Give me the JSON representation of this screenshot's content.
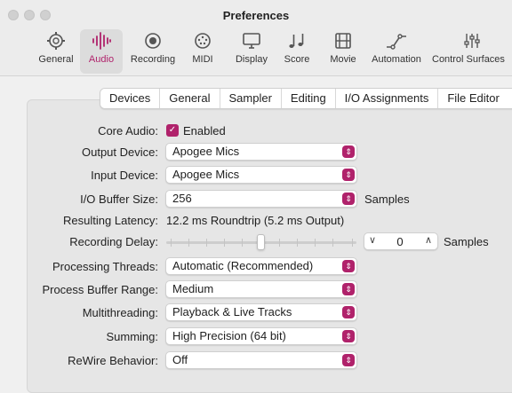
{
  "window": {
    "title": "Preferences"
  },
  "toolbar": [
    {
      "label": "General",
      "icon": "gear-icon"
    },
    {
      "label": "Audio",
      "icon": "waveform-icon"
    },
    {
      "label": "Recording",
      "icon": "record-icon"
    },
    {
      "label": "MIDI",
      "icon": "midi-icon"
    },
    {
      "label": "Display",
      "icon": "display-icon"
    },
    {
      "label": "Score",
      "icon": "notes-icon"
    },
    {
      "label": "Movie",
      "icon": "film-icon"
    },
    {
      "label": "Automation",
      "icon": "automation-icon"
    },
    {
      "label": "Control Surfaces",
      "icon": "sliders-icon"
    }
  ],
  "selected_tab": "Audio",
  "subtabs": [
    "Devices",
    "General",
    "Sampler",
    "Editing",
    "I/O Assignments",
    "File Editor"
  ],
  "accent_color": "#b0226b",
  "settings": {
    "core_audio": {
      "label": "Core Audio:",
      "checkbox_label": "Enabled",
      "checked": true
    },
    "output_device": {
      "label": "Output Device:",
      "value": "Apogee Mics"
    },
    "input_device": {
      "label": "Input Device:",
      "value": "Apogee Mics"
    },
    "io_buffer": {
      "label": "I/O Buffer Size:",
      "value": "256",
      "suffix": "Samples"
    },
    "latency": {
      "label": "Resulting Latency:",
      "value": "12.2 ms Roundtrip (5.2 ms Output)"
    },
    "recording_delay": {
      "label": "Recording Delay:",
      "value": "0",
      "suffix": "Samples"
    },
    "processing_threads": {
      "label": "Processing Threads:",
      "value": "Automatic (Recommended)"
    },
    "process_buffer": {
      "label": "Process Buffer Range:",
      "value": "Medium"
    },
    "multithreading": {
      "label": "Multithreading:",
      "value": "Playback & Live Tracks"
    },
    "summing": {
      "label": "Summing:",
      "value": "High Precision (64 bit)"
    },
    "rewire": {
      "label": "ReWire Behavior:",
      "value": "Off"
    }
  }
}
